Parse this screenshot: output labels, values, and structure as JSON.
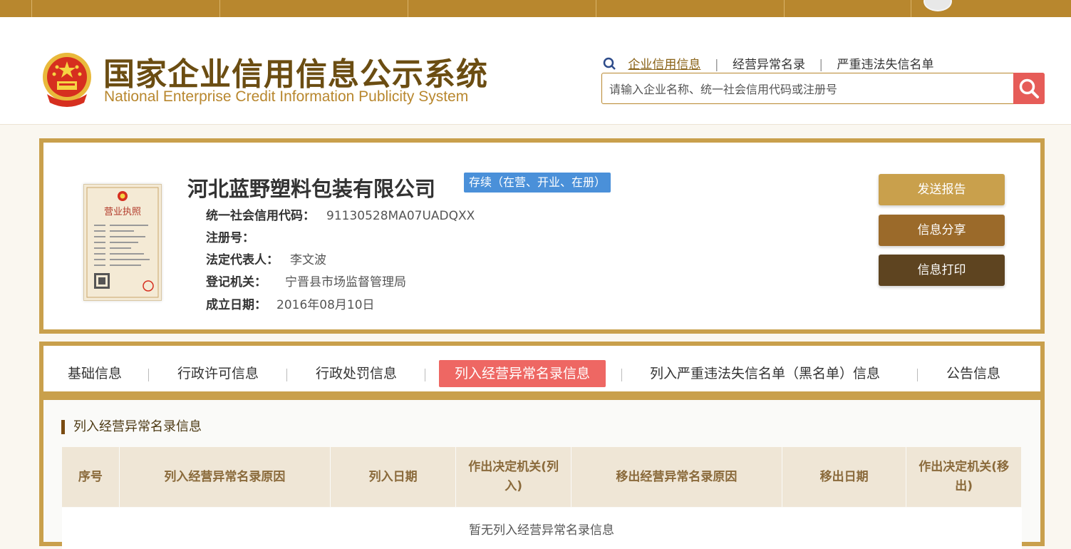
{
  "site": {
    "title": "国家企业信用信息公示系统",
    "subtitle": "National Enterprise Credit Information Publicity System"
  },
  "quicklinks": [
    "企业信用信息",
    "经营异常名录",
    "严重违法失信名单"
  ],
  "search": {
    "placeholder": "请输入企业名称、统一社会信用代码或注册号"
  },
  "company": {
    "name": "河北蓝野塑料包装有限公司",
    "status": "存续（在营、开业、在册）",
    "fields": [
      {
        "label": "统一社会信用代码：",
        "value": "91130528MA07UADQXX"
      },
      {
        "label": "注册号：",
        "value": ""
      },
      {
        "label": "法定代表人：",
        "value": "李文波"
      },
      {
        "label": "登记机关：",
        "value": "宁晋县市场监督管理局"
      },
      {
        "label": "成立日期：",
        "value": "2016年08月10日"
      }
    ]
  },
  "license_image": {
    "title": "营业执照"
  },
  "actions": {
    "send_report": "发送报告",
    "share": "信息分享",
    "print": "信息打印"
  },
  "tabs": [
    "基础信息",
    "行政许可信息",
    "行政处罚信息",
    "列入经营异常名录信息",
    "列入严重违法失信名单（黑名单）信息",
    "公告信息"
  ],
  "section": {
    "title": "列入经营异常名录信息",
    "columns": [
      "序号",
      "列入经营异常名录原因",
      "列入日期",
      "作出决定机关(列入)",
      "移出经营异常名录原因",
      "移出日期",
      "作出决定机关(移出)"
    ],
    "empty_message": "暂无列入经营异常名录信息"
  },
  "colors": {
    "brand_gold": "#c9a04c",
    "brand_brown": "#6b4d12",
    "status_blue": "#4a90d9",
    "active_tab": "#ee6763",
    "btn_send": "#c9a04c",
    "btn_share": "#9b6a2a",
    "btn_print": "#5e4420"
  }
}
